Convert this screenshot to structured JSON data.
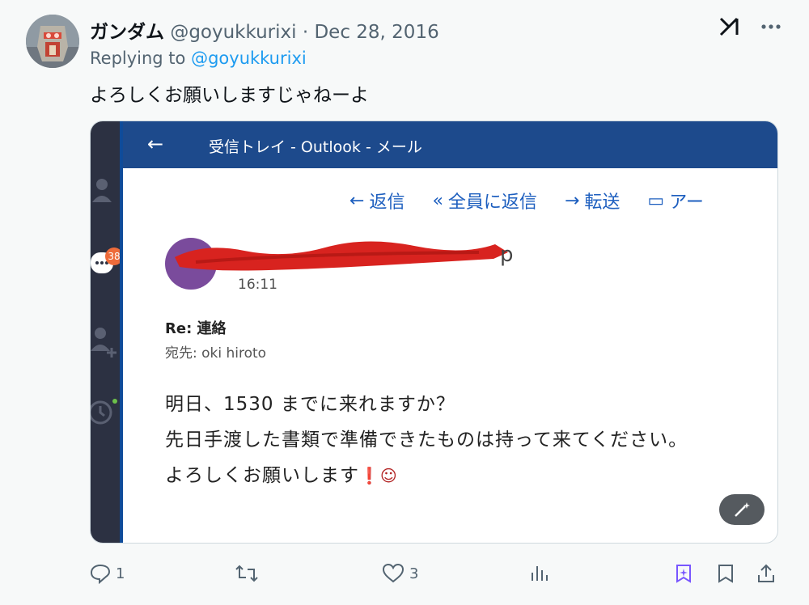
{
  "author": {
    "name": "ガンダム",
    "handle": "@goyukkurixi",
    "separator": "·",
    "date": "Dec 28, 2016"
  },
  "reply": {
    "prefix": "Replying to",
    "mention": "@goyukkurixi"
  },
  "tweet_text": "よろしくお願いしますじゃねーよ",
  "top_icons": [
    "grok-icon",
    "more-icon"
  ],
  "media": {
    "window_title": "受信トレイ - Outlook - メール",
    "back_arrow": "←",
    "sidebar_badge": "38",
    "actions": [
      {
        "icon": "reply-arrow-icon",
        "label": "返信",
        "glyph": "←"
      },
      {
        "icon": "reply-all-icon",
        "label": "全員に返信",
        "glyph": "«"
      },
      {
        "icon": "forward-arrow-icon",
        "label": "転送",
        "glyph": "→"
      },
      {
        "icon": "archive-icon",
        "label": "アー",
        "glyph": "▭"
      }
    ],
    "sender_suffix": "p",
    "sender_time": "16:11",
    "subject": "Re: 連絡",
    "to_line": "宛先: oki hiroto",
    "body": [
      "明日、1530 までに来れますか？",
      "先日手渡した書類で準備できたものは持って来てください。",
      "よろしくお願いします"
    ],
    "body_end_glyphs": "❗☺"
  },
  "stats": {
    "replies": "1",
    "likes": "3"
  },
  "colors": {
    "accent": "#1d9bf0",
    "outlook_title": "#1d4a8c",
    "outlook_link": "#1e5fbf",
    "bookmark_purple": "#7856ff",
    "redaction": "#d8231f"
  }
}
